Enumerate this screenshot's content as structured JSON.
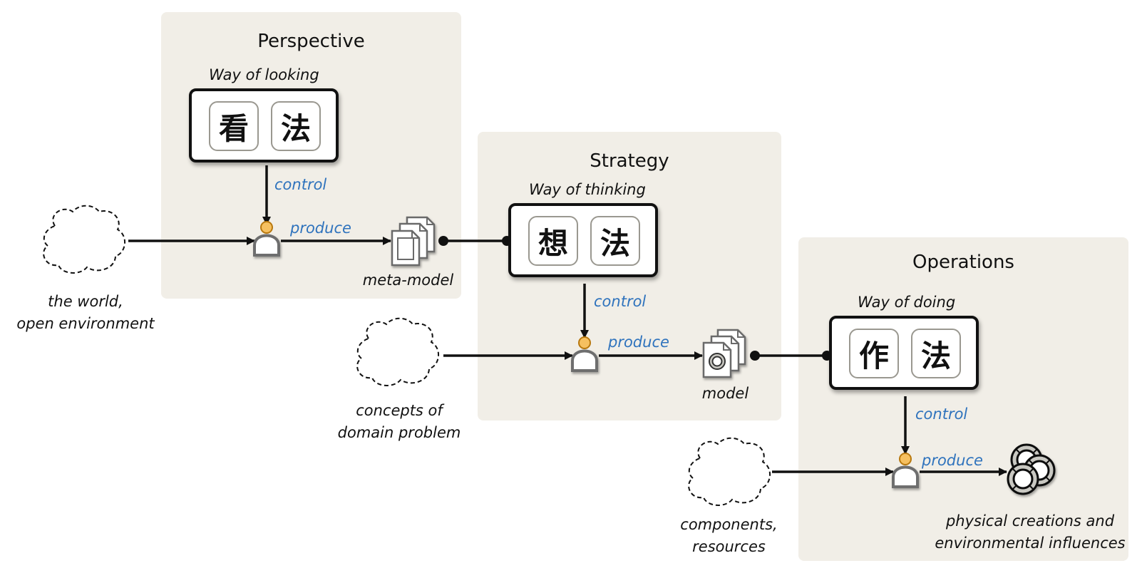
{
  "panels": [
    {
      "id": "perspective",
      "title": "Perspective",
      "way_label": "Way of looking",
      "chars": [
        "看",
        "法"
      ]
    },
    {
      "id": "strategy",
      "title": "Strategy",
      "way_label": "Way of thinking",
      "chars": [
        "想",
        "法"
      ]
    },
    {
      "id": "operations",
      "title": "Operations",
      "way_label": "Way of doing",
      "chars": [
        "作",
        "法"
      ]
    }
  ],
  "edge_labels": {
    "control": "control",
    "produce": "produce"
  },
  "inputs": [
    {
      "id": "world",
      "lines": [
        "the world,",
        "open environment"
      ]
    },
    {
      "id": "concepts",
      "lines": [
        "concepts of",
        "domain problem"
      ]
    },
    {
      "id": "components",
      "lines": [
        "components,",
        "resources"
      ]
    }
  ],
  "outputs": [
    {
      "id": "meta-model",
      "label": "meta-model"
    },
    {
      "id": "model",
      "label": "model"
    },
    {
      "id": "physical",
      "lines": [
        "physical creations and",
        "environmental influences"
      ]
    }
  ],
  "colors": {
    "panel_bg": "#f1eee7",
    "label_blue": "#2f73bd",
    "actor_head": "#f6c060",
    "actor_head_stroke": "#b8780e",
    "icon_gray": "#c9c8c2"
  }
}
